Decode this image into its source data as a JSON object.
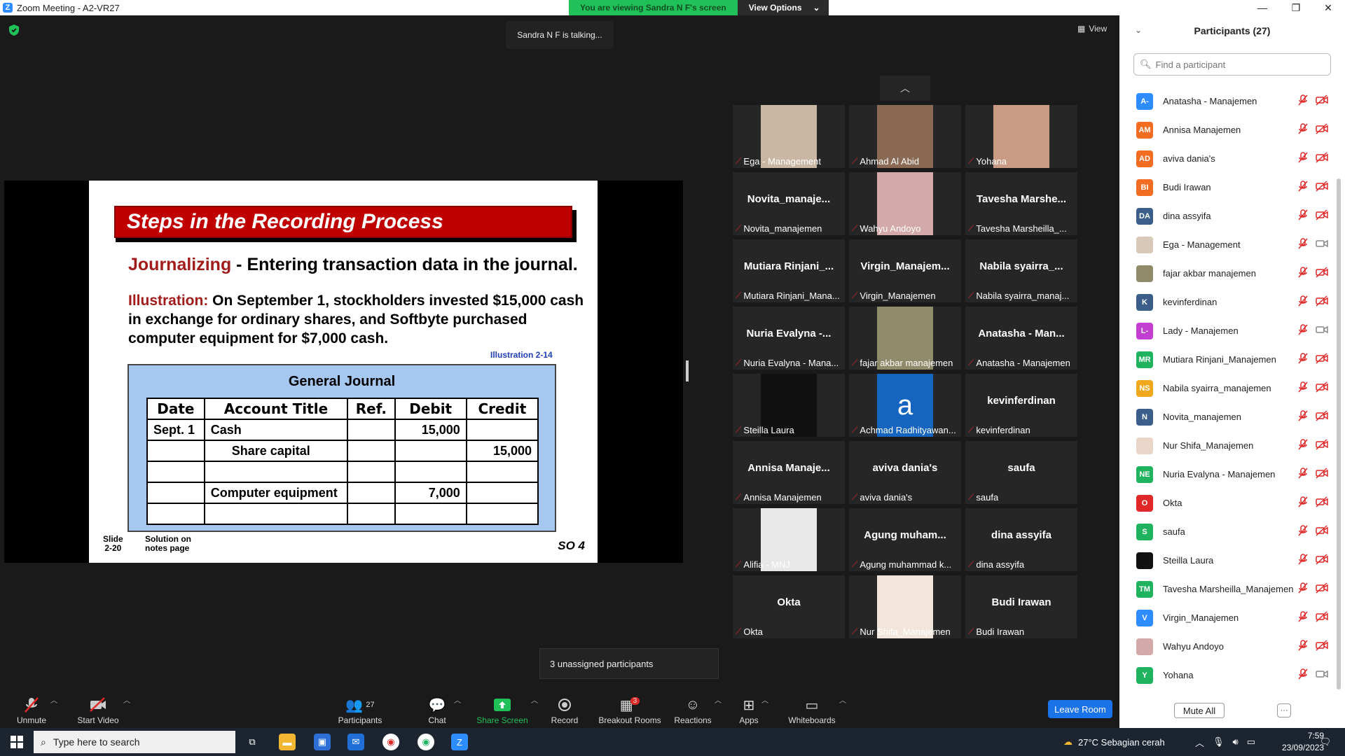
{
  "window": {
    "title": "Zoom Meeting - A2-VR27",
    "minimize": "—",
    "restore": "❐",
    "close": "✕"
  },
  "share_banner": {
    "viewing": "You are viewing Sandra N F's screen",
    "view_options": "View Options"
  },
  "talking_indicator": "Sandra N F is talking...",
  "view_button": "View",
  "slide": {
    "header": "Steps in the Recording Process",
    "line1_red": "Journalizing",
    "line1_rest": " - Entering transaction data in the journal.",
    "line2_red": "Illustration:",
    "line2_rest": "  On September 1, stockholders invested $15,000 cash in exchange for ordinary shares, and Softbyte purchased computer equipment for $7,000 cash.",
    "illustration_ref": "Illustration 2-14",
    "journal_title": "General Journal",
    "columns": [
      "Date",
      "Account Title",
      "Ref.",
      "Debit",
      "Credit"
    ],
    "rows": [
      [
        "Sept. 1",
        "Cash",
        "",
        "15,000",
        ""
      ],
      [
        "",
        "Share capital",
        "",
        "",
        "15,000"
      ],
      [
        "",
        "",
        "",
        "",
        ""
      ],
      [
        "",
        "Computer equipment",
        "",
        "7,000",
        ""
      ],
      [
        "",
        "",
        "",
        "",
        ""
      ]
    ],
    "slide_no_1": "Slide",
    "slide_no_2": "2-20",
    "solution_1": "Solution on",
    "solution_2": "notes page",
    "so": "SO 4"
  },
  "tiles": [
    {
      "name": "",
      "label": "Ega - Management",
      "photo": true,
      "photo_color": "#c9b7a4"
    },
    {
      "name": "",
      "label": "Ahmad Al Abid",
      "photo": true,
      "photo_color": "#8a6a55"
    },
    {
      "name": "",
      "label": "Yohana",
      "photo": true,
      "photo_color": "#c99b85"
    },
    {
      "name": "Novita_manaje...",
      "label": "Novita_manajemen",
      "photo": false
    },
    {
      "name": "",
      "label": "Wahyu Andoyo",
      "photo": true,
      "photo_color": "#d4a9a9"
    },
    {
      "name": "Tavesha Marshe...",
      "label": "Tavesha Marsheilla_...",
      "photo": false
    },
    {
      "name": "Mutiara Rinjani_...",
      "label": "Mutiara Rinjani_Mana...",
      "photo": false
    },
    {
      "name": "Virgin_Manajem...",
      "label": "Virgin_Manajemen",
      "photo": false
    },
    {
      "name": "Nabila syairra_...",
      "label": "Nabila syairra_manaj...",
      "photo": false
    },
    {
      "name": "Nuria Evalyna -...",
      "label": "Nuria Evalyna - Mana...",
      "photo": false
    },
    {
      "name": "",
      "label": "fajar akbar manajemen",
      "photo": true,
      "photo_color": "#8f8a6a"
    },
    {
      "name": "Anatasha - Man...",
      "label": "Anatasha - Manajemen",
      "photo": false
    },
    {
      "name": "",
      "label": "Steilla Laura",
      "photo": true,
      "photo_color": "#111111"
    },
    {
      "name": "a",
      "label": "Achmad Radhityawan...",
      "photo": true,
      "photo_color": "#1565c0"
    },
    {
      "name": "kevinferdinan",
      "label": "kevinferdinan",
      "photo": false
    },
    {
      "name": "Annisa Manaje...",
      "label": "Annisa Manajemen",
      "photo": false
    },
    {
      "name": "aviva dania's",
      "label": "aviva dania's",
      "photo": false
    },
    {
      "name": "saufa",
      "label": "saufa",
      "photo": false
    },
    {
      "name": "",
      "label": "Alifia - MNJ",
      "photo": true,
      "photo_color": "#e8e8e8"
    },
    {
      "name": "Agung muham...",
      "label": "Agung muhammad k...",
      "photo": false
    },
    {
      "name": "dina assyifa",
      "label": "dina assyifa",
      "photo": false
    },
    {
      "name": "Okta",
      "label": "Okta",
      "photo": false
    },
    {
      "name": "",
      "label": "Nur Shifa_Manajemen",
      "photo": true,
      "photo_color": "#f2e6dc"
    },
    {
      "name": "Budi Irawan",
      "label": "Budi Irawan",
      "photo": false
    }
  ],
  "unassigned": "3 unassigned participants",
  "toolbar": {
    "unmute": "Unmute",
    "start_video": "Start Video",
    "participants": "Participants",
    "participants_count": "27",
    "chat": "Chat",
    "share_screen": "Share Screen",
    "record": "Record",
    "breakout_rooms": "Breakout Rooms",
    "breakout_badge": "3",
    "reactions": "Reactions",
    "apps": "Apps",
    "whiteboards": "Whiteboards",
    "leave_room": "Leave Room"
  },
  "panel": {
    "title": "Participants (27)",
    "search_placeholder": "Find a participant",
    "mute_all": "Mute All",
    "more": "···",
    "participants": [
      {
        "initials": "A-",
        "name": "Anatasha - Manajemen",
        "color": "#2d8cff",
        "video_on": false
      },
      {
        "initials": "AM",
        "name": "Annisa Manajemen",
        "color": "#f26d21",
        "video_on": false
      },
      {
        "initials": "AD",
        "name": "aviva dania's",
        "color": "#f26d21",
        "video_on": false
      },
      {
        "initials": "BI",
        "name": "Budi Irawan",
        "color": "#f26d21",
        "video_on": false
      },
      {
        "initials": "DA",
        "name": "dina assyifa",
        "color": "#3b5f8a",
        "video_on": false
      },
      {
        "initials": "",
        "name": "Ega - Management",
        "color": "#d8c8b8",
        "video_on": true
      },
      {
        "initials": "",
        "name": "fajar akbar manajemen",
        "color": "#8f8a6a",
        "video_on": false
      },
      {
        "initials": "K",
        "name": "kevinferdinan",
        "color": "#3b5f8a",
        "video_on": false
      },
      {
        "initials": "L-",
        "name": "Lady - Manajemen",
        "color": "#c23fd1",
        "video_on": true
      },
      {
        "initials": "MR",
        "name": "Mutiara Rinjani_Manajemen",
        "color": "#1fb35f",
        "video_on": false
      },
      {
        "initials": "NS",
        "name": "Nabila syairra_manajemen",
        "color": "#f2a81d",
        "video_on": false
      },
      {
        "initials": "N",
        "name": "Novita_manajemen",
        "color": "#3b5f8a",
        "video_on": false
      },
      {
        "initials": "",
        "name": "Nur Shifa_Manajemen",
        "color": "#e9d6c9",
        "video_on": false
      },
      {
        "initials": "NE",
        "name": "Nuria Evalyna - Manajemen",
        "color": "#1fb35f",
        "video_on": false
      },
      {
        "initials": "O",
        "name": "Okta",
        "color": "#e02828",
        "video_on": false
      },
      {
        "initials": "S",
        "name": "saufa",
        "color": "#1fb35f",
        "video_on": false
      },
      {
        "initials": "",
        "name": "Steilla Laura",
        "color": "#111111",
        "video_on": false
      },
      {
        "initials": "TM",
        "name": "Tavesha Marsheilla_Manajemen",
        "color": "#1fb35f",
        "video_on": false
      },
      {
        "initials": "V",
        "name": "Virgin_Manajemen",
        "color": "#2d8cff",
        "video_on": false
      },
      {
        "initials": "",
        "name": "Wahyu Andoyo",
        "color": "#d4a9a9",
        "video_on": false
      },
      {
        "initials": "Y",
        "name": "Yohana",
        "color": "#1fb35f",
        "video_on": true
      }
    ]
  },
  "taskbar": {
    "search_placeholder": "Type here to search",
    "weather": "27°C  Sebagian cerah",
    "time": "7:59",
    "date": "23/09/2023"
  }
}
